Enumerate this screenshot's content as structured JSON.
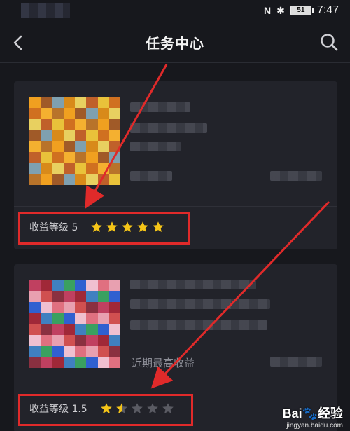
{
  "status_bar": {
    "nfc": "N",
    "bluetooth": "✱",
    "battery": "51",
    "time": "7:47"
  },
  "header": {
    "title": "任务中心"
  },
  "cards": [
    {
      "level_label": "收益等级 5",
      "rating": 5,
      "max_rating": 5
    },
    {
      "subtitle": "近期最高收益",
      "level_label": "收益等级 1.5",
      "rating": 1.5,
      "max_rating": 5
    }
  ],
  "colors": {
    "background": "#17181d",
    "card": "#22232a",
    "star_on": "#f5c518",
    "star_off": "#5a5b63",
    "annotation": "#e02a2a"
  },
  "watermark": {
    "main": "Bai🐾经验",
    "sub": "jingyan.baidu.com"
  }
}
